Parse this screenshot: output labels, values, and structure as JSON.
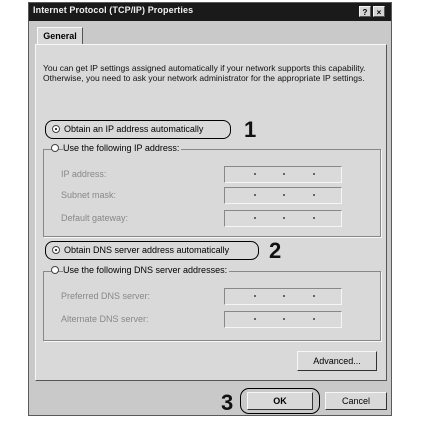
{
  "window": {
    "title": "Internet Protocol (TCP/IP) Properties",
    "help_btn": "?",
    "close_btn": "×"
  },
  "tab": {
    "label": "General"
  },
  "description": "You can get IP settings assigned automatically if your network supports this capability. Otherwise, you need to ask your network administrator for the appropriate IP settings.",
  "ip": {
    "auto_label": "Obtain an IP address automatically",
    "manual_label": "Use the following IP address:",
    "fields": [
      {
        "label": "IP address:",
        "value": ". . ."
      },
      {
        "label": "Subnet mask:",
        "value": ". . ."
      },
      {
        "label": "Default gateway:",
        "value": ". . ."
      }
    ]
  },
  "dns": {
    "auto_label": "Obtain DNS server address automatically",
    "manual_label": "Use the following DNS server addresses:",
    "fields": [
      {
        "label": "Preferred DNS server:",
        "value": ". . ."
      },
      {
        "label": "Alternate DNS server:",
        "value": ". . ."
      }
    ]
  },
  "buttons": {
    "advanced": "Advanced...",
    "ok": "OK",
    "cancel": "Cancel"
  },
  "callouts": {
    "one": "1",
    "two": "2",
    "three": "3"
  },
  "selected": {
    "ip_mode": "automatic",
    "dns_mode": "automatic"
  }
}
